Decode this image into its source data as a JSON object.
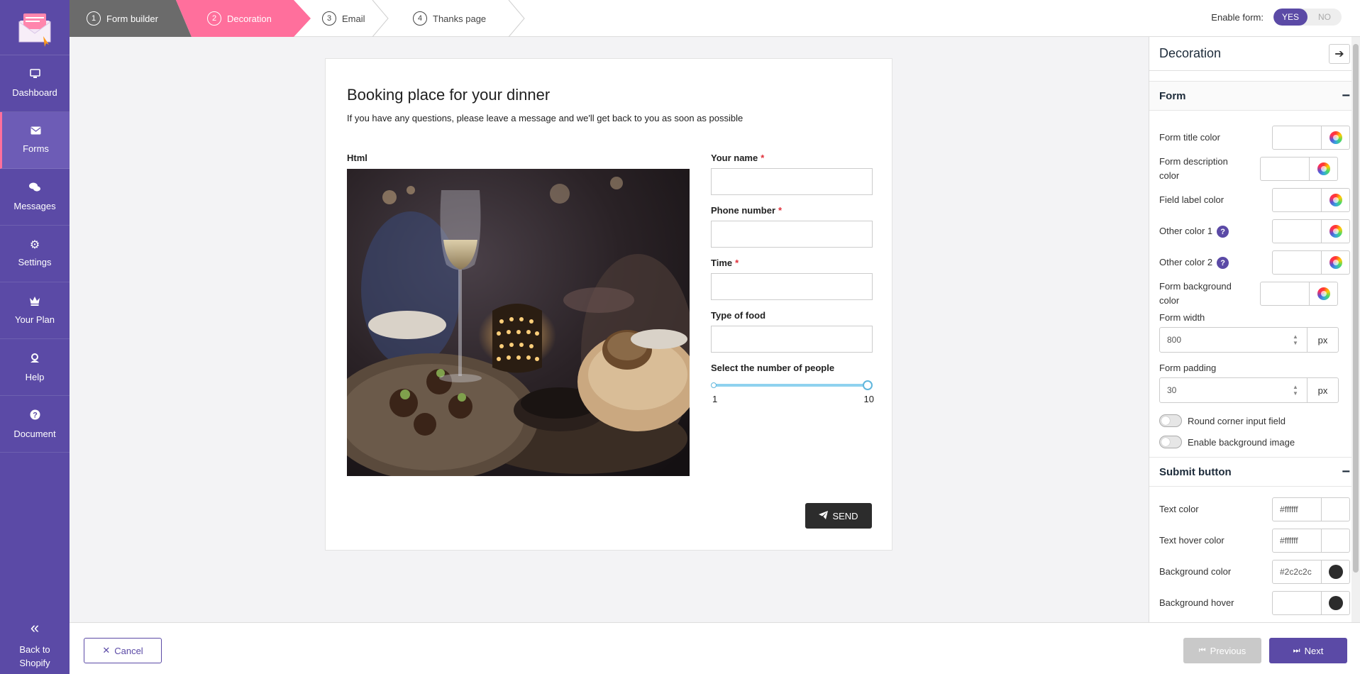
{
  "sidebar": {
    "items": [
      {
        "label": "Dashboard",
        "icon": "monitor-icon"
      },
      {
        "label": "Forms",
        "icon": "envelope-icon"
      },
      {
        "label": "Messages",
        "icon": "chat-icon"
      },
      {
        "label": "Settings",
        "icon": "gear-icon"
      },
      {
        "label": "Your Plan",
        "icon": "crown-icon"
      },
      {
        "label": "Help",
        "icon": "support-icon"
      },
      {
        "label": "Document",
        "icon": "question-icon"
      }
    ],
    "back_label": "Back to Shopify"
  },
  "steps": [
    {
      "num": "1",
      "label": "Form builder"
    },
    {
      "num": "2",
      "label": "Decoration"
    },
    {
      "num": "3",
      "label": "Email"
    },
    {
      "num": "4",
      "label": "Thanks page"
    }
  ],
  "enable_form": {
    "label": "Enable form:",
    "yes": "YES",
    "no": "NO"
  },
  "form": {
    "title": "Booking place for your dinner",
    "description": "If you have any questions, please leave a message and we'll get back to you as soon as possible",
    "html_label": "Html",
    "fields": [
      {
        "label": "Your name",
        "required": "*"
      },
      {
        "label": "Phone number",
        "required": "*"
      },
      {
        "label": "Time",
        "required": "*"
      },
      {
        "label": "Type of food",
        "required": ""
      }
    ],
    "slider": {
      "label": "Select the number of people",
      "min": "1",
      "max": "10"
    },
    "send_label": "SEND"
  },
  "panel": {
    "title": "Decoration",
    "form_section": "Form",
    "color_rows": [
      {
        "label": "Form title color"
      },
      {
        "label": "Form description color"
      },
      {
        "label": "Field label color"
      },
      {
        "label": "Other color 1"
      },
      {
        "label": "Other color 2"
      },
      {
        "label": "Form background color"
      }
    ],
    "form_width": {
      "label": "Form width",
      "value": "800",
      "unit": "px"
    },
    "form_padding": {
      "label": "Form padding",
      "value": "30",
      "unit": "px"
    },
    "round_corner_label": "Round corner input field",
    "bg_image_label": "Enable background image",
    "submit_section": "Submit button",
    "submit_rows": [
      {
        "label": "Text color",
        "value": "#ffffff"
      },
      {
        "label": "Text hover color",
        "value": "#ffffff"
      },
      {
        "label": "Background color",
        "value": "#2c2c2c"
      },
      {
        "label": "Background hover",
        "value": ""
      }
    ]
  },
  "bottom": {
    "cancel": "Cancel",
    "previous": "Previous",
    "next": "Next"
  },
  "colors": {
    "brand": "#5b4aa6",
    "accent": "#ff6f9c",
    "button_dark": "#2c2c2c"
  }
}
